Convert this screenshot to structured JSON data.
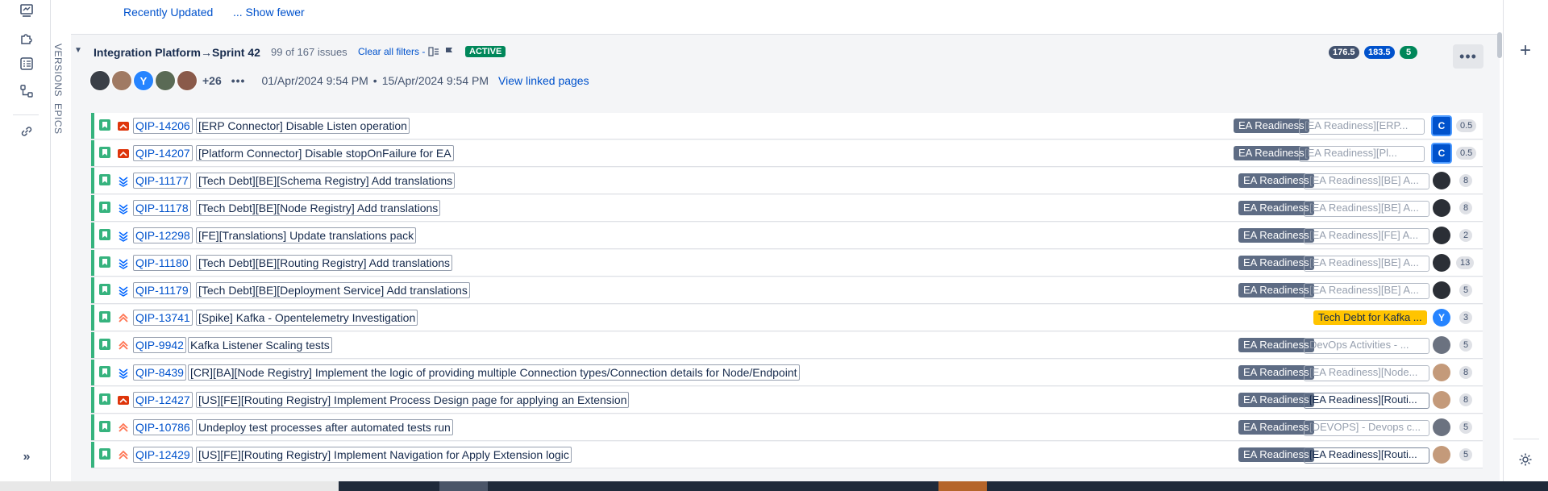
{
  "header": {
    "recently_updated": "Recently Updated",
    "show_fewer": "... Show fewer"
  },
  "side_tabs": {
    "versions": "VERSIONS",
    "epics": "EPICS"
  },
  "sprint": {
    "title": "Integration Platform→Sprint 42",
    "issue_count": "99 of 167 issues",
    "clear_filters": "Clear all filters -",
    "status": "ACTIVE",
    "points_todo": "176.5",
    "points_inprogress": "183.5",
    "points_done": "5",
    "more_label": "•••",
    "extra_people": "+26",
    "people_more": "•••",
    "start_date": "01/Apr/2024 9:54 PM",
    "date_sep": "•",
    "end_date": "15/Apr/2024 9:54 PM",
    "linked_pages": "View linked pages",
    "avatars": [
      {
        "initial": "",
        "color": "#3a3f47"
      },
      {
        "initial": "",
        "color": "#a07a63"
      },
      {
        "initial": "Y",
        "color": "#2684ff"
      },
      {
        "initial": "",
        "color": "#5a6a55"
      },
      {
        "initial": "",
        "color": "#8a5a4a"
      }
    ]
  },
  "issues": [
    {
      "key": "QIP-14206",
      "summary": "[ERP Connector] Disable Listen operation",
      "priority": "highest",
      "epic": "EA Readiness",
      "field": "[EA Readiness][ERP...",
      "field_dark": false,
      "assignee": "C",
      "assignee_style": "c",
      "assignee_color": "#0052cc",
      "estimate": "0.5"
    },
    {
      "key": "QIP-14207",
      "summary": "[Platform Connector] Disable stopOnFailure for EA",
      "priority": "highest",
      "epic": "EA Readiness",
      "field": "[EA Readiness][Pl...",
      "field_dark": false,
      "assignee": "C",
      "assignee_style": "c",
      "assignee_color": "#0052cc",
      "estimate": "0.5"
    },
    {
      "key": "QIP-11177",
      "summary": "[Tech Debt][BE][Schema Registry] Add translations",
      "priority": "lowest",
      "epic": "EA Readiness",
      "field": "[EA Readiness][BE] A...",
      "field_dark": false,
      "assignee": "",
      "assignee_style": "p",
      "assignee_color": "#2b2f36",
      "estimate": "8"
    },
    {
      "key": "QIP-11178",
      "summary": "[Tech Debt][BE][Node Registry] Add translations",
      "priority": "lowest",
      "epic": "EA Readiness",
      "field": "[EA Readiness][BE] A...",
      "field_dark": false,
      "assignee": "",
      "assignee_style": "p",
      "assignee_color": "#2b2f36",
      "estimate": "8"
    },
    {
      "key": "QIP-12298",
      "summary": "[FE][Translations] Update translations pack",
      "priority": "lowest",
      "epic": "EA Readiness",
      "field": "[EA Readiness][FE] A...",
      "field_dark": false,
      "assignee": "",
      "assignee_style": "p",
      "assignee_color": "#2b2f36",
      "estimate": "2"
    },
    {
      "key": "QIP-11180",
      "summary": "[Tech Debt][BE][Routing Registry] Add translations",
      "priority": "lowest",
      "epic": "EA Readiness",
      "field": "[EA Readiness][BE] A...",
      "field_dark": false,
      "assignee": "",
      "assignee_style": "p",
      "assignee_color": "#2b2f36",
      "estimate": "13"
    },
    {
      "key": "QIP-11179",
      "summary": "[Tech Debt][BE][Deployment Service] Add translations",
      "priority": "lowest",
      "epic": "EA Readiness",
      "field": "[EA Readiness][BE] A...",
      "field_dark": false,
      "assignee": "",
      "assignee_style": "p",
      "assignee_color": "#2b2f36",
      "estimate": "5"
    },
    {
      "key": "QIP-13741",
      "summary": "[Spike] Kafka - Opentelemetry Investigation",
      "priority": "high",
      "epic": "Tech Debt for Kafka ...",
      "epic_yellow": true,
      "field": "",
      "field_dark": false,
      "assignee": "Y",
      "assignee_style": "y",
      "assignee_color": "#2684ff",
      "estimate": "3"
    },
    {
      "key": "QIP-9942",
      "summary": "Kafka Listener Scaling tests",
      "priority": "high",
      "epic": "EA Readiness",
      "field": "DevOps Activities - ...",
      "field_dark": false,
      "assignee": "",
      "assignee_style": "p",
      "assignee_color": "#6b7280",
      "estimate": "5"
    },
    {
      "key": "QIP-8439",
      "summary": "[CR][BA][Node Registry] Implement the logic of providing multiple Connection types/Connection details for Node/Endpoint",
      "priority": "lowest",
      "epic": "EA Readiness",
      "field": "[EA Readiness][Node...",
      "field_dark": false,
      "assignee": "",
      "assignee_style": "p",
      "assignee_color": "#c49a7a",
      "estimate": "8"
    },
    {
      "key": "QIP-12427",
      "summary": "[US][FE][Routing Registry] Implement Process Design page for applying an Extension",
      "priority": "highest",
      "epic": "EA Readiness",
      "field": "[EA Readiness][Routi...",
      "field_dark": true,
      "assignee": "",
      "assignee_style": "p",
      "assignee_color": "#c49a7a",
      "estimate": "8"
    },
    {
      "key": "QIP-10786",
      "summary": "Undeploy test processes after automated tests run",
      "priority": "high",
      "epic": "EA Readiness",
      "field": "[DEVOPS] - Devops c...",
      "field_dark": false,
      "assignee": "",
      "assignee_style": "p",
      "assignee_color": "#6b7280",
      "estimate": "5"
    },
    {
      "key": "QIP-12429",
      "summary": "[US][FE][Routing Registry] Implement Navigation for Apply Extension logic",
      "priority": "high",
      "epic": "EA Readiness",
      "field": "[EA Readiness][Routi...",
      "field_dark": true,
      "assignee": "",
      "assignee_style": "p",
      "assignee_color": "#c49a7a",
      "estimate": "5"
    }
  ]
}
